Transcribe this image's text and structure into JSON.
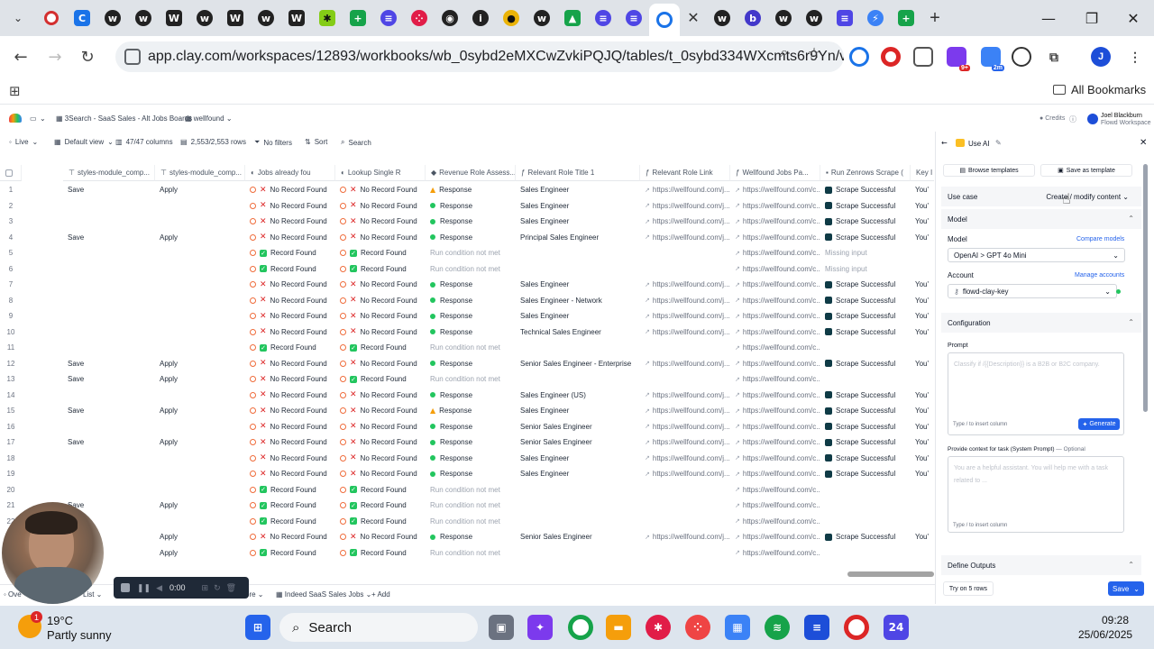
{
  "browser": {
    "url": "app.clay.com/workspaces/12893/workbooks/wb_0sybd2eMXCwZvkiPQJQ/tables/t_0sybd334WXcmts6r9Yn/vi...",
    "bookmarks_label": "All Bookmarks",
    "profile_initial": "J",
    "ext_badge_1": "9+",
    "ext_badge_2": "2m",
    "close_glyph": "✕",
    "new_tab_glyph": "+"
  },
  "app": {
    "breadcrumb_1": "3Search - SaaS Sales - Alt Jobs Boards",
    "breadcrumb_2": "wellfound",
    "credits": "Credits",
    "user_name": "Joel Blackburn",
    "user_workspace": "Flowd Workspace"
  },
  "toolbar": {
    "live": "Live",
    "view": "Default view",
    "columns": "47/47 columns",
    "rows": "2,553/2,553 rows",
    "filters": "No filters",
    "sort": "Sort",
    "search": "Search"
  },
  "columns": [
    "styles-module_comp...",
    "styles-module_comp...",
    "Jobs already fou",
    "Lookup Single R",
    "Revenue Role Assess...",
    "Relevant Role Title 1",
    "Relevant Role Link",
    "Wellfound Jobs Pa...",
    "Run Zenrows Scrape (",
    "Key I"
  ],
  "rows": [
    {
      "n": "1",
      "c1": "Save",
      "c2": "Apply",
      "jobs": "No Record Found",
      "jobs_ok": false,
      "lookup": "No Record Found",
      "lookup_ok": false,
      "rev": "Response",
      "rev_state": "warn",
      "title": "Sales Engineer",
      "link": "https://wellfound.com/j...",
      "wf": "https://wellfound.com/c...",
      "scrape": "Scrape Successful",
      "key": "You'"
    },
    {
      "n": "2",
      "c1": "",
      "c2": "",
      "jobs": "No Record Found",
      "jobs_ok": false,
      "lookup": "No Record Found",
      "lookup_ok": false,
      "rev": "Response",
      "rev_state": "ok",
      "title": "Sales Engineer",
      "link": "https://wellfound.com/j...",
      "wf": "https://wellfound.com/c...",
      "scrape": "Scrape Successful",
      "key": "You'"
    },
    {
      "n": "3",
      "c1": "",
      "c2": "",
      "jobs": "No Record Found",
      "jobs_ok": false,
      "lookup": "No Record Found",
      "lookup_ok": false,
      "rev": "Response",
      "rev_state": "ok",
      "title": "Sales Engineer",
      "link": "https://wellfound.com/j...",
      "wf": "https://wellfound.com/c...",
      "scrape": "Scrape Successful",
      "key": "You'"
    },
    {
      "n": "4",
      "c1": "Save",
      "c2": "Apply",
      "jobs": "No Record Found",
      "jobs_ok": false,
      "lookup": "No Record Found",
      "lookup_ok": false,
      "rev": "Response",
      "rev_state": "ok",
      "title": "Principal Sales Engineer",
      "link": "https://wellfound.com/j...",
      "wf": "https://wellfound.com/c...",
      "scrape": "Scrape Successful",
      "key": "You'"
    },
    {
      "n": "5",
      "c1": "",
      "c2": "",
      "jobs": "Record Found",
      "jobs_ok": true,
      "lookup": "Record Found",
      "lookup_ok": true,
      "rev": "Run condition not met",
      "rev_state": "none",
      "title": "",
      "link": "",
      "wf": "https://wellfound.com/c...",
      "scrape": "Missing input",
      "key": ""
    },
    {
      "n": "6",
      "c1": "",
      "c2": "",
      "jobs": "Record Found",
      "jobs_ok": true,
      "lookup": "Record Found",
      "lookup_ok": true,
      "rev": "Run condition not met",
      "rev_state": "none",
      "title": "",
      "link": "",
      "wf": "https://wellfound.com/c...",
      "scrape": "Missing input",
      "key": ""
    },
    {
      "n": "7",
      "c1": "",
      "c2": "",
      "jobs": "No Record Found",
      "jobs_ok": false,
      "lookup": "No Record Found",
      "lookup_ok": false,
      "rev": "Response",
      "rev_state": "ok",
      "title": "Sales Engineer",
      "link": "https://wellfound.com/j...",
      "wf": "https://wellfound.com/c...",
      "scrape": "Scrape Successful",
      "key": "You'"
    },
    {
      "n": "8",
      "c1": "",
      "c2": "",
      "jobs": "No Record Found",
      "jobs_ok": false,
      "lookup": "No Record Found",
      "lookup_ok": false,
      "rev": "Response",
      "rev_state": "ok",
      "title": "Sales Engineer - Network",
      "link": "https://wellfound.com/j...",
      "wf": "https://wellfound.com/c...",
      "scrape": "Scrape Successful",
      "key": "You'"
    },
    {
      "n": "9",
      "c1": "",
      "c2": "",
      "jobs": "No Record Found",
      "jobs_ok": false,
      "lookup": "No Record Found",
      "lookup_ok": false,
      "rev": "Response",
      "rev_state": "ok",
      "title": "Sales Engineer",
      "link": "https://wellfound.com/j...",
      "wf": "https://wellfound.com/c...",
      "scrape": "Scrape Successful",
      "key": "You'"
    },
    {
      "n": "10",
      "c1": "",
      "c2": "",
      "jobs": "No Record Found",
      "jobs_ok": false,
      "lookup": "No Record Found",
      "lookup_ok": false,
      "rev": "Response",
      "rev_state": "ok",
      "title": "Technical Sales Engineer",
      "link": "https://wellfound.com/j...",
      "wf": "https://wellfound.com/c...",
      "scrape": "Scrape Successful",
      "key": "You'"
    },
    {
      "n": "11",
      "c1": "",
      "c2": "",
      "jobs": "Record Found",
      "jobs_ok": true,
      "lookup": "Record Found",
      "lookup_ok": true,
      "rev": "Run condition not met",
      "rev_state": "none",
      "title": "",
      "link": "",
      "wf": "https://wellfound.com/c...",
      "scrape": "",
      "key": ""
    },
    {
      "n": "12",
      "c1": "Save",
      "c2": "Apply",
      "jobs": "No Record Found",
      "jobs_ok": false,
      "lookup": "No Record Found",
      "lookup_ok": false,
      "rev": "Response",
      "rev_state": "ok",
      "title": "Senior Sales Engineer - Enterprise",
      "link": "https://wellfound.com/j...",
      "wf": "https://wellfound.com/c...",
      "scrape": "Scrape Successful",
      "key": "You'"
    },
    {
      "n": "13",
      "c1": "Save",
      "c2": "Apply",
      "jobs": "No Record Found",
      "jobs_ok": false,
      "lookup": "Record Found",
      "lookup_ok": true,
      "rev": "Run condition not met",
      "rev_state": "none",
      "title": "",
      "link": "",
      "wf": "https://wellfound.com/c...",
      "scrape": "",
      "key": ""
    },
    {
      "n": "14",
      "c1": "",
      "c2": "",
      "jobs": "No Record Found",
      "jobs_ok": false,
      "lookup": "No Record Found",
      "lookup_ok": false,
      "rev": "Response",
      "rev_state": "ok",
      "title": "Sales Engineer (US)",
      "link": "https://wellfound.com/j...",
      "wf": "https://wellfound.com/c...",
      "scrape": "Scrape Successful",
      "key": "You'"
    },
    {
      "n": "15",
      "c1": "Save",
      "c2": "Apply",
      "jobs": "No Record Found",
      "jobs_ok": false,
      "lookup": "No Record Found",
      "lookup_ok": false,
      "rev": "Response",
      "rev_state": "warn",
      "title": "Sales Engineer",
      "link": "https://wellfound.com/j...",
      "wf": "https://wellfound.com/c...",
      "scrape": "Scrape Successful",
      "key": "You'"
    },
    {
      "n": "16",
      "c1": "",
      "c2": "",
      "jobs": "No Record Found",
      "jobs_ok": false,
      "lookup": "No Record Found",
      "lookup_ok": false,
      "rev": "Response",
      "rev_state": "ok",
      "title": "Senior Sales Engineer",
      "link": "https://wellfound.com/j...",
      "wf": "https://wellfound.com/c...",
      "scrape": "Scrape Successful",
      "key": "You'"
    },
    {
      "n": "17",
      "c1": "Save",
      "c2": "Apply",
      "jobs": "No Record Found",
      "jobs_ok": false,
      "lookup": "No Record Found",
      "lookup_ok": false,
      "rev": "Response",
      "rev_state": "ok",
      "title": "Senior Sales Engineer",
      "link": "https://wellfound.com/j...",
      "wf": "https://wellfound.com/c...",
      "scrape": "Scrape Successful",
      "key": "You'"
    },
    {
      "n": "18",
      "c1": "",
      "c2": "",
      "jobs": "No Record Found",
      "jobs_ok": false,
      "lookup": "No Record Found",
      "lookup_ok": false,
      "rev": "Response",
      "rev_state": "ok",
      "title": "Sales Engineer",
      "link": "https://wellfound.com/j...",
      "wf": "https://wellfound.com/c...",
      "scrape": "Scrape Successful",
      "key": "You'"
    },
    {
      "n": "19",
      "c1": "",
      "c2": "",
      "jobs": "No Record Found",
      "jobs_ok": false,
      "lookup": "No Record Found",
      "lookup_ok": false,
      "rev": "Response",
      "rev_state": "ok",
      "title": "Sales Engineer",
      "link": "https://wellfound.com/j...",
      "wf": "https://wellfound.com/c...",
      "scrape": "Scrape Successful",
      "key": "You'"
    },
    {
      "n": "20",
      "c1": "",
      "c2": "",
      "jobs": "Record Found",
      "jobs_ok": true,
      "lookup": "Record Found",
      "lookup_ok": true,
      "rev": "Run condition not met",
      "rev_state": "none",
      "title": "",
      "link": "",
      "wf": "https://wellfound.com/c...",
      "scrape": "",
      "key": ""
    },
    {
      "n": "21",
      "c1": "Save",
      "c2": "Apply",
      "jobs": "Record Found",
      "jobs_ok": true,
      "lookup": "Record Found",
      "lookup_ok": true,
      "rev": "Run condition not met",
      "rev_state": "none",
      "title": "",
      "link": "",
      "wf": "https://wellfound.com/c...",
      "scrape": "",
      "key": ""
    },
    {
      "n": "22",
      "c1": "",
      "c2": "",
      "jobs": "Record Found",
      "jobs_ok": true,
      "lookup": "Record Found",
      "lookup_ok": true,
      "rev": "Run condition not met",
      "rev_state": "none",
      "title": "",
      "link": "",
      "wf": "https://wellfound.com/c...",
      "scrape": "",
      "key": ""
    },
    {
      "n": "23",
      "c1": "",
      "c2": "Apply",
      "jobs": "No Record Found",
      "jobs_ok": false,
      "lookup": "No Record Found",
      "lookup_ok": false,
      "rev": "Response",
      "rev_state": "ok",
      "title": "Senior Sales Engineer",
      "link": "https://wellfound.com/j...",
      "wf": "https://wellfound.com/c...",
      "scrape": "Scrape Successful",
      "key": "You'"
    },
    {
      "n": "24",
      "c1": "",
      "c2": "Apply",
      "jobs": "Record Found",
      "jobs_ok": true,
      "lookup": "Record Found",
      "lookup_ok": true,
      "rev": "Run condition not met",
      "rev_state": "none",
      "title": "",
      "link": "",
      "wf": "https://wellfound.com/c...",
      "scrape": "",
      "key": ""
    }
  ],
  "footer": {
    "tab_indeed": "Indeed SaaS Sales Jobs",
    "add": "Add",
    "rec_time": "0:00"
  },
  "panel": {
    "title": "Use AI",
    "browse_templates": "Browse templates",
    "save_as_template": "Save as template",
    "use_case_label": "Use case",
    "use_case_value": "Create / modify content",
    "model_section": "Model",
    "model_label": "Model",
    "compare_models": "Compare models",
    "model_value": "OpenAI > GPT 4o Mini",
    "account_label": "Account",
    "manage_accounts": "Manage accounts",
    "account_value": "flowd-clay-key",
    "config_section": "Configuration",
    "prompt_label": "Prompt",
    "prompt_placeholder": "Classify if /{{Description}} is a B2B or B2C company.",
    "prompt_hint": "Type / to insert column",
    "generate": "Generate",
    "system_label": "Provide context for task (System Prompt)",
    "optional": "— Optional",
    "system_placeholder": "You are a helpful assistant. You will help me with a task related to ...",
    "system_hint": "Type / to insert column",
    "define_outputs": "Define Outputs",
    "try_rows": "Try on 5 rows",
    "save": "Save"
  },
  "taskbar": {
    "weather_temp": "19°C",
    "weather_desc": "Partly sunny",
    "weather_badge": "1",
    "search": "Search",
    "time": "09:28",
    "date": "25/06/2025"
  },
  "colors": {
    "accent_blue": "#2563eb",
    "error_red": "#dc2626",
    "success_green": "#22c55e",
    "warning_amber": "#f59e0b"
  }
}
